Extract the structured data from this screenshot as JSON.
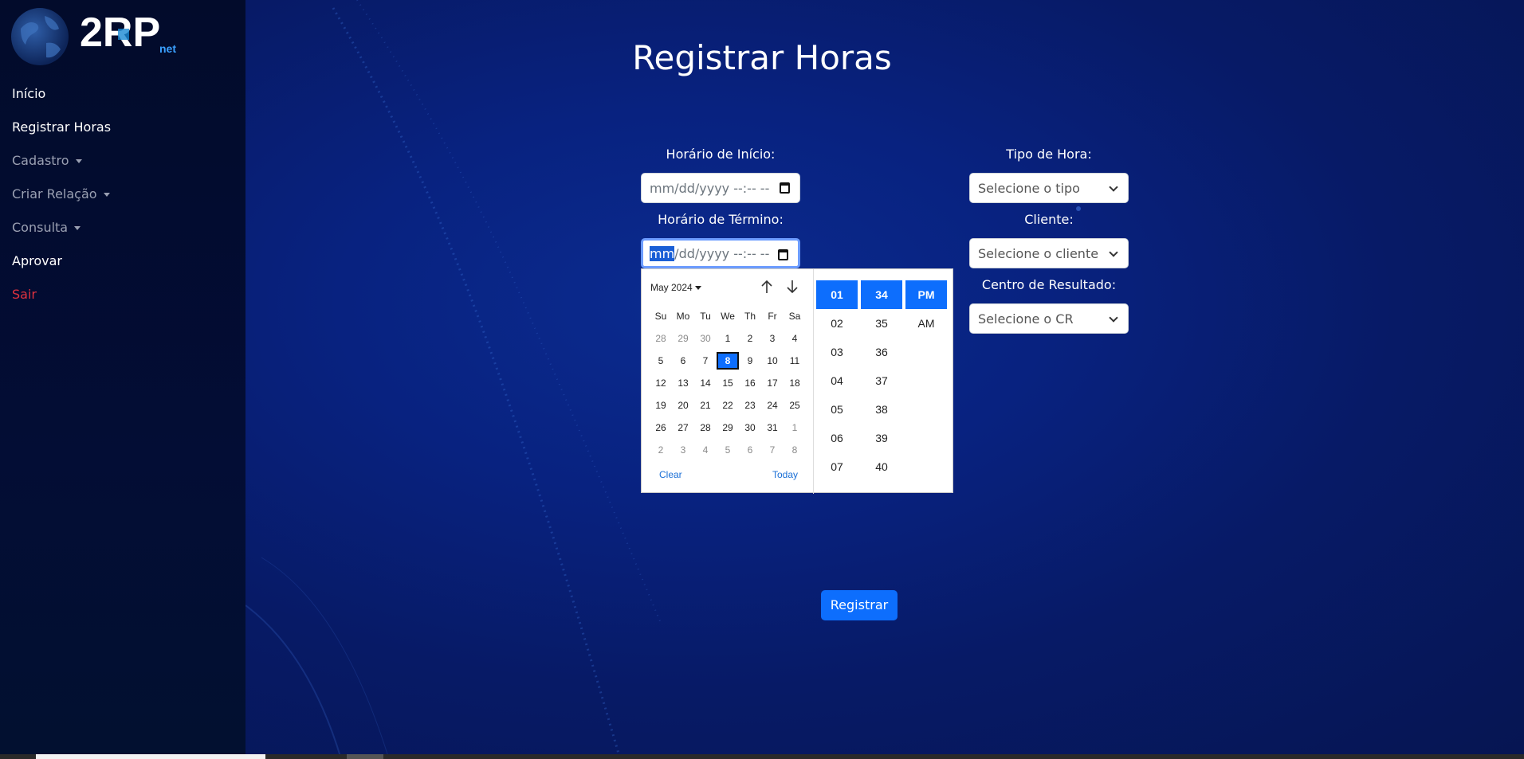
{
  "sidebar": {
    "logo_text": "2RP",
    "logo_sub": "net",
    "items": [
      {
        "label": "Início"
      },
      {
        "label": "Registrar Horas"
      },
      {
        "label": "Cadastro"
      },
      {
        "label": "Criar Relação"
      },
      {
        "label": "Consulta"
      },
      {
        "label": "Aprovar"
      },
      {
        "label": "Sair"
      }
    ]
  },
  "page": {
    "title": "Registrar Horas",
    "start_label": "Horário de Início:",
    "start_placeholder": "mm/dd/yyyy --:-- --",
    "end_label": "Horário de Término:",
    "end_mm": "mm",
    "end_rest": "/dd/yyyy --:-- --",
    "type_label": "Tipo de Hora:",
    "type_select": "Selecione o tipo",
    "client_label": "Cliente:",
    "client_select": "Selecione o cliente",
    "cr_label": "Centro de Resultado:",
    "cr_select": "Selecione o CR",
    "submit": "Registrar"
  },
  "picker": {
    "month": "May 2024",
    "weekdays": [
      "Su",
      "Mo",
      "Tu",
      "We",
      "Th",
      "Fr",
      "Sa"
    ],
    "weeks": [
      [
        "28",
        "29",
        "30",
        "1",
        "2",
        "3",
        "4"
      ],
      [
        "5",
        "6",
        "7",
        "8",
        "9",
        "10",
        "11"
      ],
      [
        "12",
        "13",
        "14",
        "15",
        "16",
        "17",
        "18"
      ],
      [
        "19",
        "20",
        "21",
        "22",
        "23",
        "24",
        "25"
      ],
      [
        "26",
        "27",
        "28",
        "29",
        "30",
        "31",
        "1"
      ],
      [
        "2",
        "3",
        "4",
        "5",
        "6",
        "7",
        "8"
      ]
    ],
    "selected_day": "8",
    "clear": "Clear",
    "today": "Today",
    "hours": [
      "01",
      "02",
      "03",
      "04",
      "05",
      "06",
      "07"
    ],
    "minutes": [
      "34",
      "35",
      "36",
      "37",
      "38",
      "39",
      "40"
    ],
    "ampm": [
      "PM",
      "AM"
    ]
  },
  "colors": {
    "accent": "#0d6efd",
    "danger": "#e0323f",
    "sidebar_bg": "#020b2b",
    "main_bg": "#071a66"
  }
}
